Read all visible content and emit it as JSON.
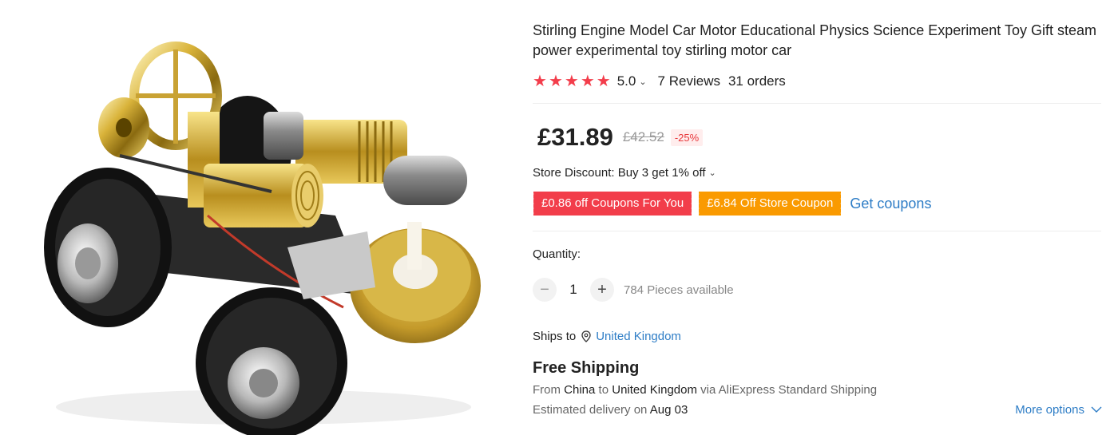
{
  "product": {
    "title": "Stirling Engine Model Car Motor Educational Physics Science Experiment Toy Gift steam power experimental toy stirling motor car",
    "image_icon": "stirling-engine-car-image"
  },
  "rating": {
    "stars_count": 5,
    "value": "5.0",
    "reviews": "7 Reviews",
    "orders": "31 orders",
    "star_color": "#f33d4b"
  },
  "price": {
    "current": "£31.89",
    "original": "£42.52",
    "discount": "-25%"
  },
  "store_discount": {
    "text": "Store Discount: Buy 3 get 1% off"
  },
  "coupons": {
    "coupon1": "£0.86 off Coupons For You",
    "coupon2": "£6.84 Off Store Coupon",
    "get_link": "Get coupons",
    "coupon1_color": "#f23d4a",
    "coupon2_color": "#fa9a00"
  },
  "quantity": {
    "label": "Quantity:",
    "minus": "−",
    "value": "1",
    "plus": "+",
    "available": "784 Pieces available"
  },
  "shipping": {
    "ships_to_label": "Ships to",
    "country": "United Kingdom",
    "free_label": "Free Shipping",
    "from_prefix": "From",
    "from_country": "China",
    "to_word": "to",
    "to_country": "United Kingdom",
    "via_text": "via AliExpress Standard Shipping",
    "delivery_prefix": "Estimated delivery on",
    "delivery_date": "Aug 03",
    "more_options": "More options"
  }
}
